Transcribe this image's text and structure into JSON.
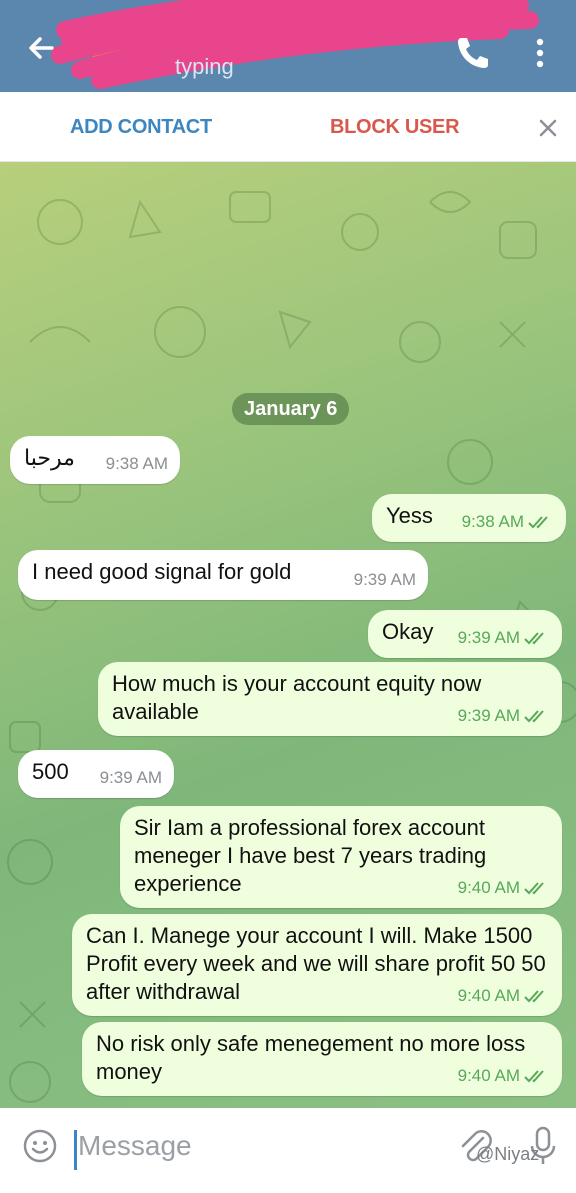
{
  "header": {
    "status": "typing",
    "icons": [
      "back-arrow-icon",
      "avatar",
      "phone-icon",
      "more-vert-icon"
    ],
    "bg_color": "#5b86ad"
  },
  "actions": {
    "add_contact": "ADD CONTACT",
    "block_user": "BLOCK USER",
    "close_icon": "close-icon"
  },
  "chat": {
    "date": "January 6",
    "messages": [
      {
        "dir": "in",
        "text": "مرحبا",
        "time": "9:38 AM"
      },
      {
        "dir": "out",
        "text": "Yess",
        "time": "9:38 AM"
      },
      {
        "dir": "in",
        "text": "I need good signal for gold",
        "time": "9:39 AM"
      },
      {
        "dir": "out",
        "text": "Okay",
        "time": "9:39 AM"
      },
      {
        "dir": "out",
        "text": "How much is your account equity now available",
        "time": "9:39 AM"
      },
      {
        "dir": "in",
        "text": "500",
        "time": "9:39 AM"
      },
      {
        "dir": "out",
        "text": "Sir Iam a professional forex account meneger I have best 7 years trading experience",
        "time": "9:40 AM"
      },
      {
        "dir": "out",
        "text": "Can I. Manege your account I will. Make 1500 Profit every week and we will share profit 50 50 after withdrawal",
        "time": "9:40 AM"
      },
      {
        "dir": "out",
        "text": "No risk only safe menegement no more loss money",
        "time": "9:40 AM"
      }
    ]
  },
  "input": {
    "placeholder": "Message",
    "watermark": "@Niyaz"
  },
  "colors": {
    "outgoing_bubble": "#efffde",
    "incoming_bubble": "#ffffff",
    "add_contact": "#3c86c2",
    "block_user": "#d8584e",
    "read_ticks": "#59a85a"
  }
}
